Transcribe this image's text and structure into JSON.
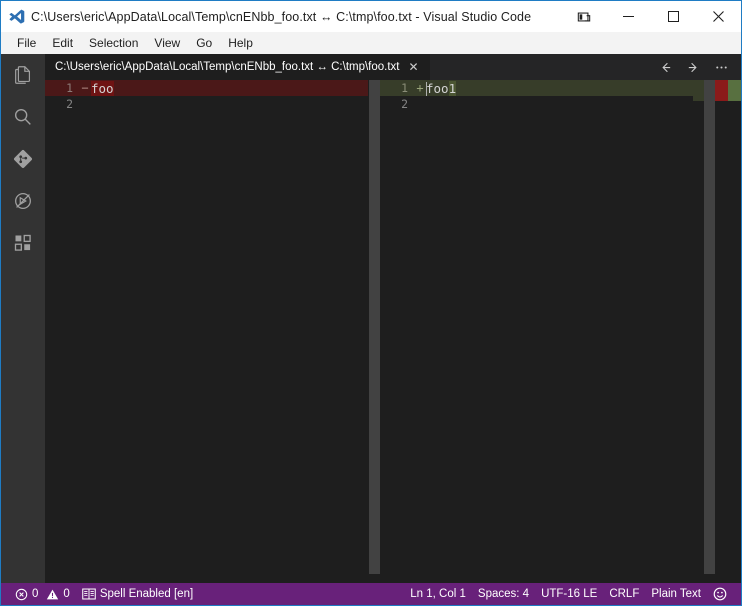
{
  "window": {
    "title": "C:\\Users\\eric\\AppData\\Local\\Temp\\cnENbb_foo.txt ↔ C:\\tmp\\foo.txt - Visual Studio Code",
    "logo_icon": "vscode-logo-icon",
    "layout_icon": "toggle-panel-layout-icon",
    "minimize_icon": "minimize-icon",
    "maximize_icon": "maximize-icon",
    "close_icon": "close-icon",
    "accent_border": "#1f7cc4"
  },
  "menubar": {
    "items": [
      {
        "label": "File"
      },
      {
        "label": "Edit"
      },
      {
        "label": "Selection"
      },
      {
        "label": "View"
      },
      {
        "label": "Go"
      },
      {
        "label": "Help"
      }
    ]
  },
  "activitybar": {
    "items": [
      {
        "name": "explorer",
        "icon": "files-icon"
      },
      {
        "name": "search",
        "icon": "search-icon"
      },
      {
        "name": "source-control",
        "icon": "source-control-icon"
      },
      {
        "name": "run-and-debug",
        "icon": "debug-alt-icon"
      },
      {
        "name": "extensions",
        "icon": "extensions-icon"
      }
    ]
  },
  "editor": {
    "tab": {
      "label": "C:\\Users\\eric\\AppData\\Local\\Temp\\cnENbb_foo.txt ↔ C:\\tmp\\foo.txt",
      "close_label": "✕"
    },
    "actions": [
      {
        "name": "previous-change",
        "icon": "arrow-left-icon",
        "glyph": "←"
      },
      {
        "name": "next-change",
        "icon": "arrow-right-icon",
        "glyph": "→"
      },
      {
        "name": "more-actions",
        "icon": "ellipsis-icon",
        "glyph": "···"
      }
    ]
  },
  "diff": {
    "original": {
      "lines": [
        {
          "number": "1",
          "sign": "−",
          "text": "foo",
          "state": "deleted",
          "highlight": "foo"
        },
        {
          "number": "2",
          "sign": "",
          "text": "",
          "state": "normal",
          "highlight": ""
        }
      ]
    },
    "modified": {
      "lines": [
        {
          "number": "1",
          "sign": "+",
          "text": "foo1",
          "state": "added",
          "prefix": "foo",
          "highlight": "1"
        },
        {
          "number": "2",
          "sign": "",
          "text": "",
          "state": "normal",
          "highlight": ""
        }
      ]
    },
    "colors": {
      "deleted_line_bg": "#4b1818",
      "deleted_char_bg": "#6f1313",
      "added_line_bg": "#373d29",
      "added_char_bg": "#4b5632",
      "editor_bg": "#1e1e1e"
    }
  },
  "statusbar": {
    "background": "#68217a",
    "left": [
      {
        "name": "problems",
        "error_icon": "error-circle-icon",
        "error_count": "0",
        "warning_icon": "warning-triangle-icon",
        "warning_count": "0"
      },
      {
        "name": "spell-checker",
        "icon": "book-icon",
        "label": "Spell Enabled [en]"
      }
    ],
    "right": [
      {
        "name": "cursor-position",
        "label": "Ln 1, Col 1"
      },
      {
        "name": "indentation",
        "label": "Spaces: 4"
      },
      {
        "name": "encoding",
        "label": "UTF-16 LE"
      },
      {
        "name": "eol",
        "label": "CRLF"
      },
      {
        "name": "language-mode",
        "label": "Plain Text"
      },
      {
        "name": "feedback",
        "icon": "smiley-icon",
        "label": ""
      }
    ]
  }
}
